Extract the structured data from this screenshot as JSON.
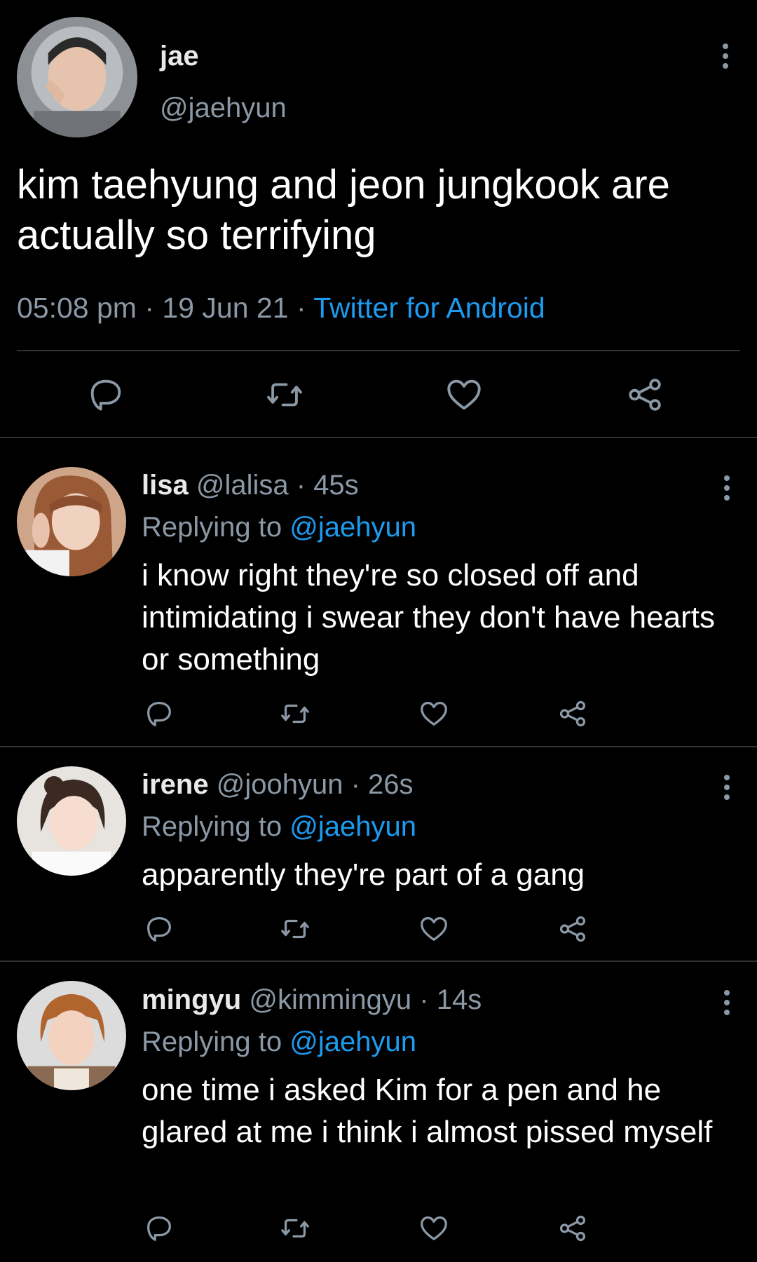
{
  "colors": {
    "background": "#000000",
    "text": "#ffffff",
    "muted": "#8b98a5",
    "accent": "#1d9bf0",
    "divider": "#2f3336"
  },
  "main_tweet": {
    "display_name": "jae",
    "handle": "@jaehyun",
    "text": "kim taehyung and jeon jungkook are actually so terrifying",
    "time": "05:08 pm",
    "date": "19 Jun 21",
    "separator": "·",
    "source": "Twitter for Android",
    "actions": [
      "reply-icon",
      "retweet-icon",
      "like-icon",
      "share-icon"
    ],
    "more_icon": "more-vertical-icon"
  },
  "replies": [
    {
      "display_name": "lisa",
      "handle": "@lalisa",
      "time": "45s",
      "replying_label": "Replying to",
      "replying_to": "@jaehyun",
      "text": "i know right they're so closed off and intimidating i swear they don't have hearts or something"
    },
    {
      "display_name": "irene",
      "handle": "@joohyun",
      "time": "26s",
      "replying_label": "Replying to",
      "replying_to": "@jaehyun",
      "text": "apparently they're part of a gang"
    },
    {
      "display_name": "mingyu",
      "handle": "@kimmingyu",
      "time": "14s",
      "replying_label": "Replying to",
      "replying_to": "@jaehyun",
      "text": "one time i asked Kim for a pen and he glared at me i think i almost pissed myself"
    }
  ]
}
